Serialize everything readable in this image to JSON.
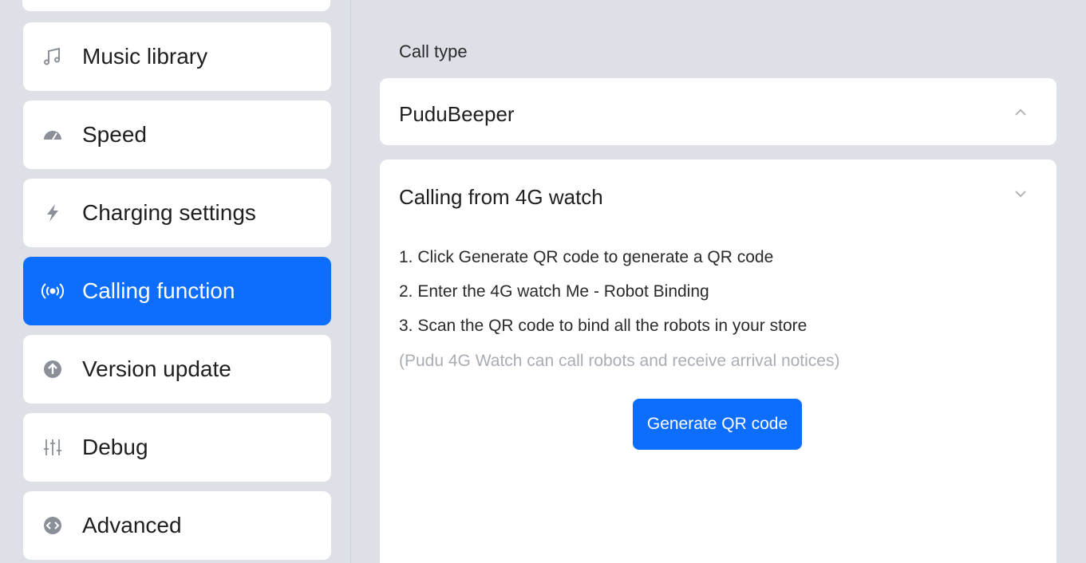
{
  "sidebar": {
    "items": [
      {
        "label": "Music library",
        "icon": "music-note-icon",
        "active": false
      },
      {
        "label": "Speed",
        "icon": "speedometer-icon",
        "active": false
      },
      {
        "label": "Charging settings",
        "icon": "lightning-icon",
        "active": false
      },
      {
        "label": "Calling function",
        "icon": "broadcast-icon",
        "active": true
      },
      {
        "label": "Version update",
        "icon": "update-arrow-icon",
        "active": false
      },
      {
        "label": "Debug",
        "icon": "sliders-icon",
        "active": false
      },
      {
        "label": "Advanced",
        "icon": "code-icon",
        "active": false
      }
    ]
  },
  "main": {
    "section_label": "Call type",
    "options": [
      {
        "title": "PuduBeeper",
        "expanded": false
      },
      {
        "title": "Calling from 4G watch",
        "expanded": true
      }
    ],
    "steps": [
      "1. Click Generate QR code to generate a QR code",
      "2. Enter the 4G watch Me - Robot Binding",
      "3. Scan the QR code to bind all the robots in your store"
    ],
    "note": "(Pudu 4G Watch can call robots and receive arrival notices)",
    "generate_button": "Generate QR code"
  },
  "colors": {
    "accent": "#0d6efd",
    "background": "#dde0e6",
    "card": "#ffffff",
    "muted_text": "#a9adb4"
  }
}
